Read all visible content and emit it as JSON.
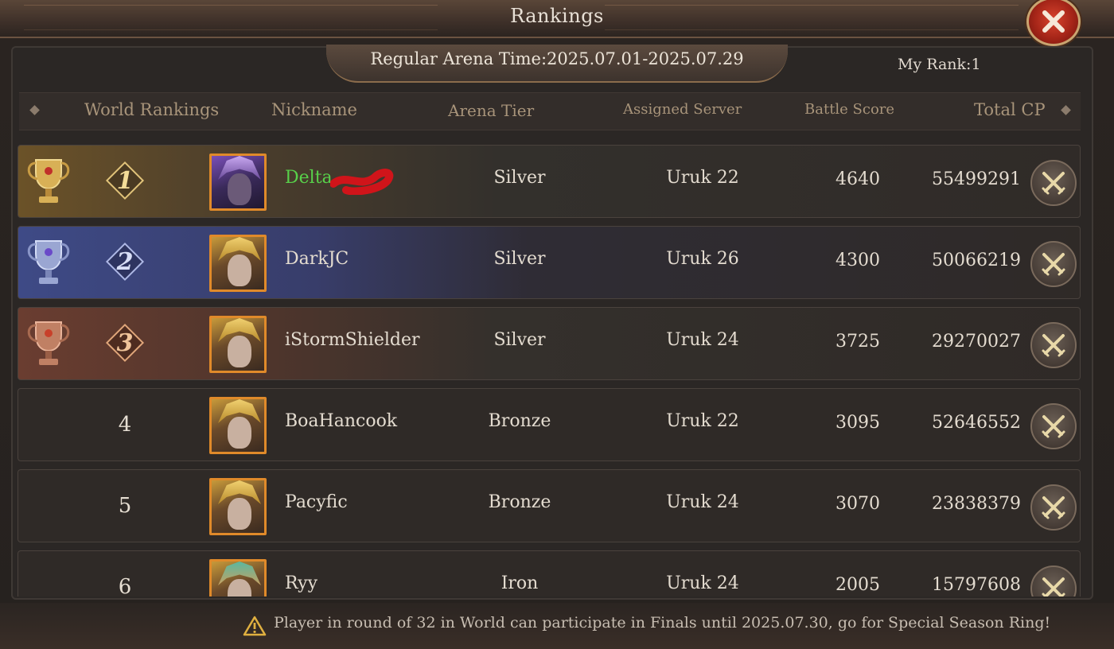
{
  "window": {
    "title": "Rankings",
    "close_icon": "close-icon"
  },
  "banner": {
    "arena_time": "Regular Arena Time:2025.07.01-2025.07.29",
    "my_rank": "My Rank:1"
  },
  "columns": {
    "world_rankings": "World Rankings",
    "nickname": "Nickname",
    "arena_tier": "Arena Tier",
    "assigned_server": "Assigned Server",
    "battle_score": "Battle Score",
    "total_cp": "Total CP"
  },
  "rows": [
    {
      "rank": "1",
      "nickname": "Delta",
      "tier": "Silver",
      "server": "Uruk 22",
      "battle_score": "4640",
      "total_cp": "55499291",
      "highlight": "gold",
      "is_me": true
    },
    {
      "rank": "2",
      "nickname": "DarkJC",
      "tier": "Silver",
      "server": "Uruk 26",
      "battle_score": "4300",
      "total_cp": "50066219",
      "highlight": "silver"
    },
    {
      "rank": "3",
      "nickname": "iStormShielder",
      "tier": "Silver",
      "server": "Uruk 24",
      "battle_score": "3725",
      "total_cp": "29270027",
      "highlight": "bronze"
    },
    {
      "rank": "4",
      "nickname": "BoaHancook",
      "tier": "Bronze",
      "server": "Uruk 22",
      "battle_score": "3095",
      "total_cp": "52646552"
    },
    {
      "rank": "5",
      "nickname": "Pacyfic",
      "tier": "Bronze",
      "server": "Uruk 24",
      "battle_score": "3070",
      "total_cp": "23838379"
    },
    {
      "rank": "6",
      "nickname": "Ryy",
      "tier": "Iron",
      "server": "Uruk 24",
      "battle_score": "2005",
      "total_cp": "15797608"
    }
  ],
  "footer": {
    "notice": "Player in round of 32 in World can participate in Finals until 2025.07.30, go for Special Season Ring!",
    "icon": "warning-icon"
  },
  "colors": {
    "me_name": "#58d04a",
    "close_red": "#c0301c",
    "gold_accent": "#e2c47a"
  }
}
